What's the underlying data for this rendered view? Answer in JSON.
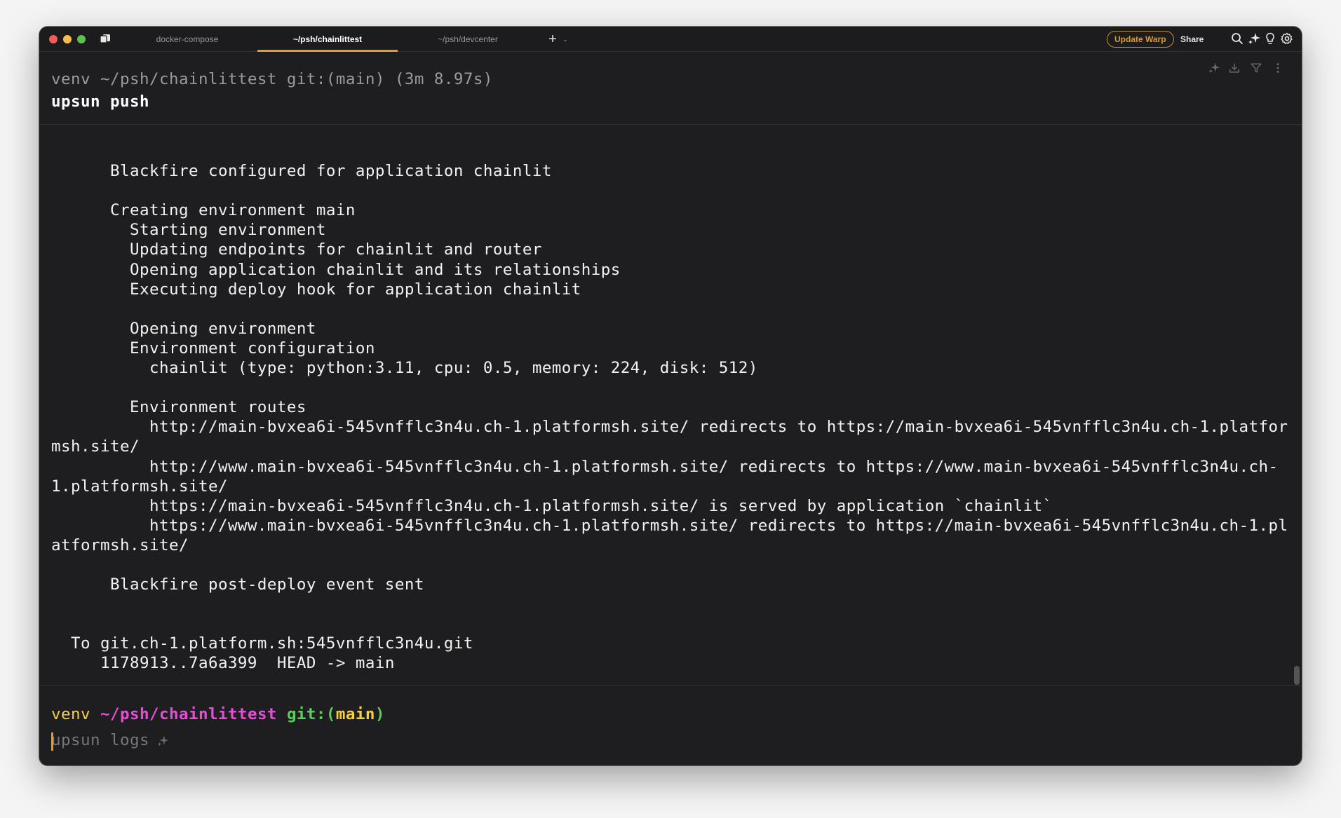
{
  "window": {
    "tabs": [
      {
        "label": "docker-compose",
        "active": false
      },
      {
        "label": "~/psh/chainlittest",
        "active": true
      },
      {
        "label": "~/psh/devcenter",
        "active": false
      }
    ],
    "new_tab_label": "+",
    "new_tab_menu_label": "⌄",
    "update_button": "Update Warp",
    "share_button": "Share",
    "accent_color": "#f0962e"
  },
  "block": {
    "prompt": "venv ~/psh/chainlittest git:(main) (3m 8.97s)",
    "command": "upsun push",
    "output_lines": [
      "",
      "      Blackfire configured for application chainlit",
      "",
      "      Creating environment main",
      "        Starting environment",
      "        Updating endpoints for chainlit and router",
      "        Opening application chainlit and its relationships",
      "        Executing deploy hook for application chainlit",
      "",
      "        Opening environment",
      "        Environment configuration",
      "          chainlit (type: python:3.11, cpu: 0.5, memory: 224, disk: 512)",
      "",
      "        Environment routes",
      "          http://main-bvxea6i-545vnfflc3n4u.ch-1.platformsh.site/ redirects to https://main-bvxea6i-545vnfflc3n4u.ch-1.platformsh.site/",
      "          http://www.main-bvxea6i-545vnfflc3n4u.ch-1.platformsh.site/ redirects to https://www.main-bvxea6i-545vnfflc3n4u.ch-1.platformsh.site/",
      "          https://main-bvxea6i-545vnfflc3n4u.ch-1.platformsh.site/ is served by application `chainlit`",
      "          https://www.main-bvxea6i-545vnfflc3n4u.ch-1.platformsh.site/ redirects to https://main-bvxea6i-545vnfflc3n4u.ch-1.platformsh.site/",
      "",
      "      Blackfire post-deploy event sent",
      "",
      "",
      "  To git.ch-1.platform.sh:545vnfflc3n4u.git",
      "     1178913..7a6a399  HEAD -> main"
    ]
  },
  "input": {
    "prompt_venv": "venv",
    "prompt_dir": "~/psh/chainlittest",
    "prompt_git": "git:(",
    "prompt_branch": "main",
    "prompt_git_close": ")",
    "suggestion": "upsun logs"
  }
}
